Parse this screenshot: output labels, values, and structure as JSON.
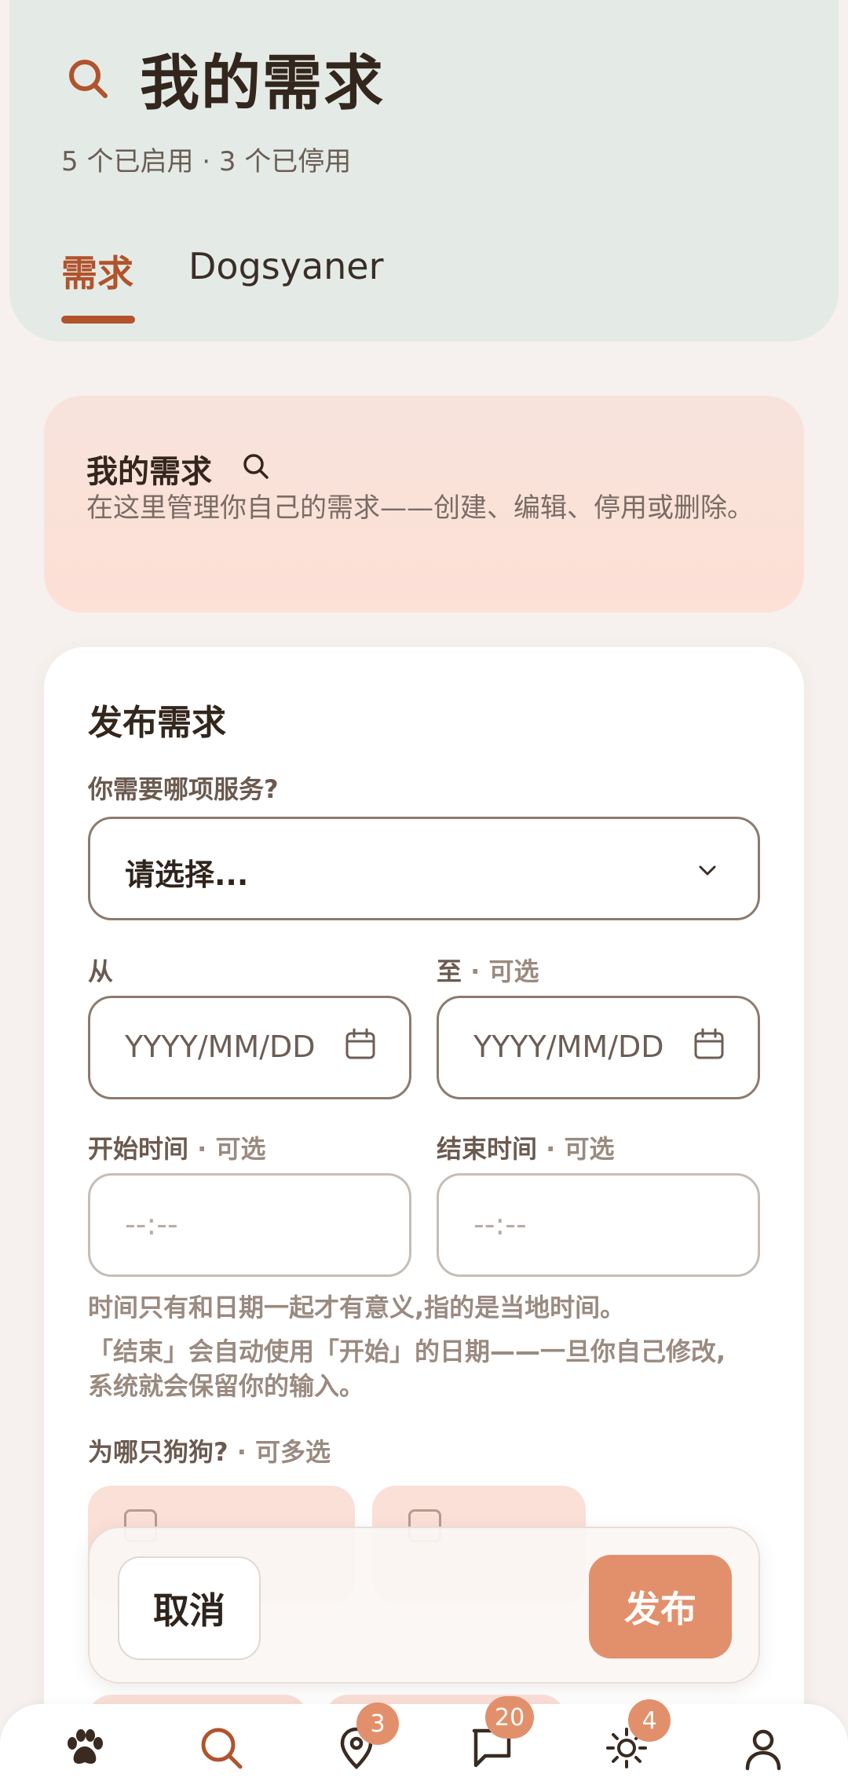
{
  "header": {
    "title": "我的需求",
    "subtitle": "5 个已启用 · 3 个已停用",
    "search_icon": "search-icon",
    "tabs": [
      {
        "label": "需求",
        "active": true
      },
      {
        "label": "Dogsyaner",
        "active": false
      }
    ]
  },
  "info_card": {
    "title": "我的需求",
    "icon": "search-icon",
    "description": "在这里管理你自己的需求——创建、编辑、停用或删除。"
  },
  "form": {
    "title": "发布需求",
    "service": {
      "label": "你需要哪项服务?",
      "value": "请选择..."
    },
    "from": {
      "label": "从",
      "placeholder": "YYYY/MM/DD"
    },
    "to": {
      "label": "至",
      "optional": "· 可选",
      "placeholder": "YYYY/MM/DD"
    },
    "start_time": {
      "label": "开始时间",
      "optional": "· 可选",
      "placeholder": "--:--"
    },
    "end_time": {
      "label": "结束时间",
      "optional": "· 可选",
      "placeholder": "--:--"
    },
    "hint_1": "时间只有和日期一起才有意义,指的是当地时间。",
    "hint_2": "「结束」会自动使用「开始」的日期——一旦你自己修改,",
    "hint_3": "系统就会保留你的输入。",
    "dogs": {
      "label": "为哪只狗狗?",
      "multi": "· 可多选"
    }
  },
  "actions": {
    "cancel": "取消",
    "publish": "发布"
  },
  "bottom_nav": {
    "items": [
      {
        "icon": "paw-icon",
        "active": false
      },
      {
        "icon": "search-icon",
        "active": true
      },
      {
        "icon": "location-pin-icon",
        "badge": "3"
      },
      {
        "icon": "chat-icon",
        "badge": "20"
      },
      {
        "icon": "sun-icon",
        "badge": "4"
      },
      {
        "icon": "profile-icon",
        "active": false
      }
    ]
  },
  "colors": {
    "accent": "#b1532c",
    "header_bg": "#e4ebe6",
    "info_bg": "#fde0d6",
    "publish_bg": "#e2906c",
    "badge_bg": "#e2906c"
  }
}
